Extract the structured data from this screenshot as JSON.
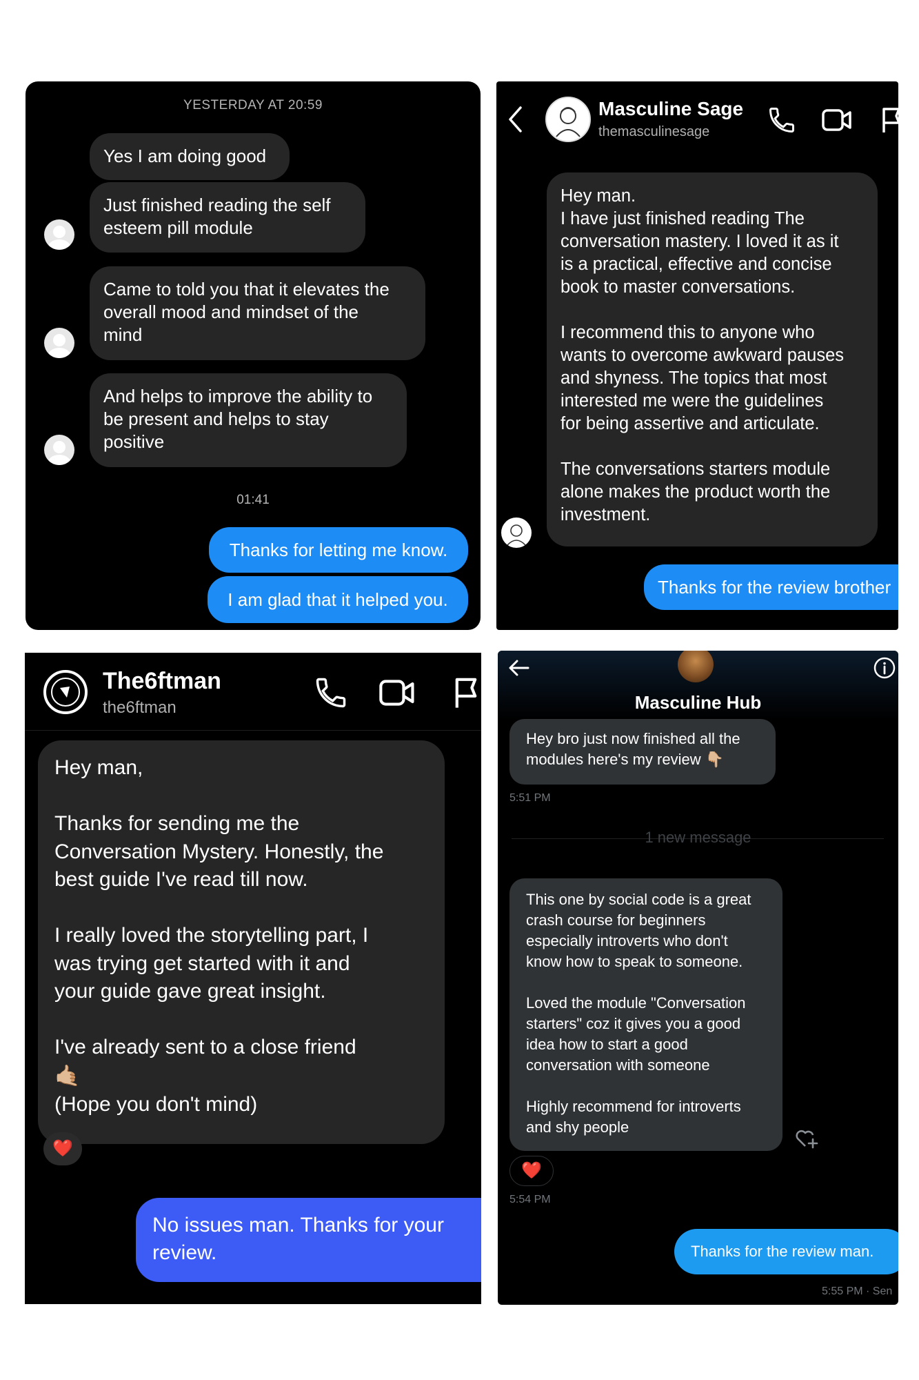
{
  "panel1": {
    "timestamp_top": "YESTERDAY AT 20:59",
    "messages_in": [
      "Yes I am doing good",
      "Just finished reading the self\nesteem pill module",
      "Came to told you that it elevates the\noverall mood and mindset of the\nmind",
      "And helps to improve the ability to\nbe present and helps to stay\npositive"
    ],
    "timestamp_mid": "01:41",
    "messages_out": [
      "Thanks for letting me know.",
      "I am glad that it helped you."
    ]
  },
  "panel2": {
    "name": "Masculine Sage",
    "handle": "themasculinesage",
    "message_in": "Hey man.\nI have just finished reading The\nconversation mastery. I loved it as it\nis a practical, effective and concise\nbook to master conversations.\n\nI recommend this to anyone who\nwants to overcome awkward pauses\nand shyness. The topics that most\ninterested me were the guidelines\nfor being assertive and articulate.\n\nThe conversations starters module\nalone makes the product worth the\ninvestment.",
    "message_out": "Thanks for the review brother"
  },
  "panel3": {
    "name": "The6ftman",
    "handle": "the6ftman",
    "message_in_1": "Hey man,\n\nThanks for sending me the\nConversation Mystery. Honestly, the\nbest guide I've read till now.\n\nI really loved the storytelling part, I\nwas trying get started with it and\nyour guide gave great insight.\n\nI've already sent to a close friend",
    "message_in_emoji": "🤙🏼",
    "message_in_2": "(Hope you don't mind)",
    "reaction": "❤️",
    "message_out": "No issues man. Thanks for your\nreview."
  },
  "panel4": {
    "name": "Masculine Hub",
    "message_1": "Hey bro just now finished all the\nmodules here's my review 👇🏼",
    "time_1": "5:51 PM",
    "divider": "1 new message",
    "message_2": "This one by social code is a great\ncrash course for beginners\nespecially introverts who don't\nknow how to speak to someone.\n\nLoved the module \"Conversation\nstarters\" coz it gives you a good\nidea how to start a good\nconversation with someone\n\nHighly recommend for introverts\nand shy people",
    "reaction": "❤️",
    "time_2": "5:54 PM",
    "message_out": "Thanks for the review man.",
    "time_out": "5:55 PM · Sen"
  }
}
